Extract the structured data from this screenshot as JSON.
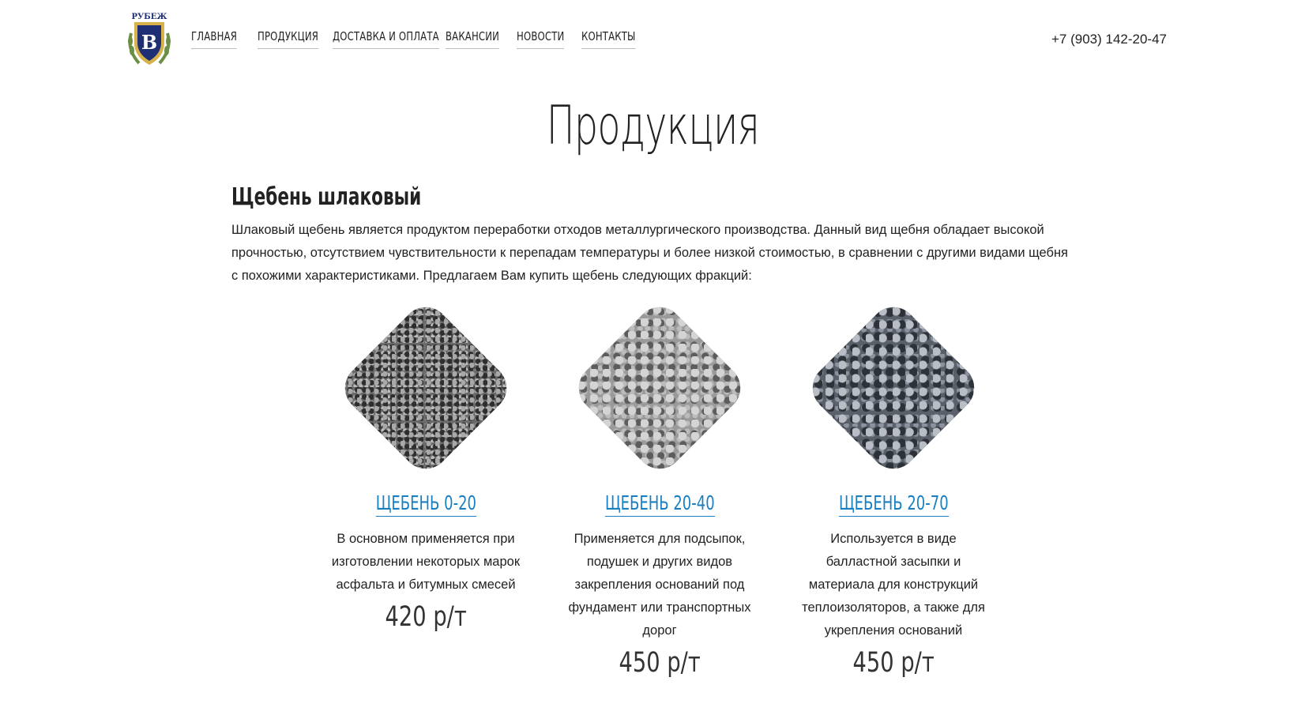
{
  "header": {
    "logo_text": "РУБЕЖ",
    "logo_letter": "В",
    "nav": [
      {
        "label": "ГЛАВНАЯ"
      },
      {
        "label": "ПРОДУКЦИЯ"
      },
      {
        "label": "ДОСТАВКА И ОПЛАТА"
      },
      {
        "label": "ВАКАНСИИ"
      },
      {
        "label": "НОВОСТИ"
      },
      {
        "label": "КОНТАКТЫ"
      }
    ],
    "phone": "+7 (903) 142-20-47"
  },
  "page": {
    "title": "Продукция",
    "section_title": "Щебень шлаковый",
    "intro": "Шлаковый щебень является продуктом переработки отходов металлургического производства. Данный вид щебня обладает высокой прочностью, отсутствием чувствительности к перепадам температуры и более низкой стоимостью, в сравнении с другими видами щебня с похожими характеристиками. Предлагаем Вам купить щебень следующих фракций:"
  },
  "products": [
    {
      "name": "ЩЕБЕНЬ 0-20",
      "desc": "В основном применяется при изготовлении некоторых марок асфальта и битумных смесей",
      "price": "420 р/т"
    },
    {
      "name": "ЩЕБЕНЬ 20-40",
      "desc": "Применяется для подсыпок, подушек и других видов закрепления оснований под фундамент или транспортных дорог",
      "price": "450 р/т"
    },
    {
      "name": "ЩЕБЕНЬ 20-70",
      "desc": "Используется в виде балластной засыпки и материала для конструкций теплоизоляторов, а также для укрепления оснований",
      "price": "450 р/т"
    }
  ],
  "colors": {
    "link": "#1a7fc1",
    "logo_shield": "#1f2f73",
    "logo_gold": "#d7b24a",
    "logo_laurel": "#6b8f45"
  }
}
